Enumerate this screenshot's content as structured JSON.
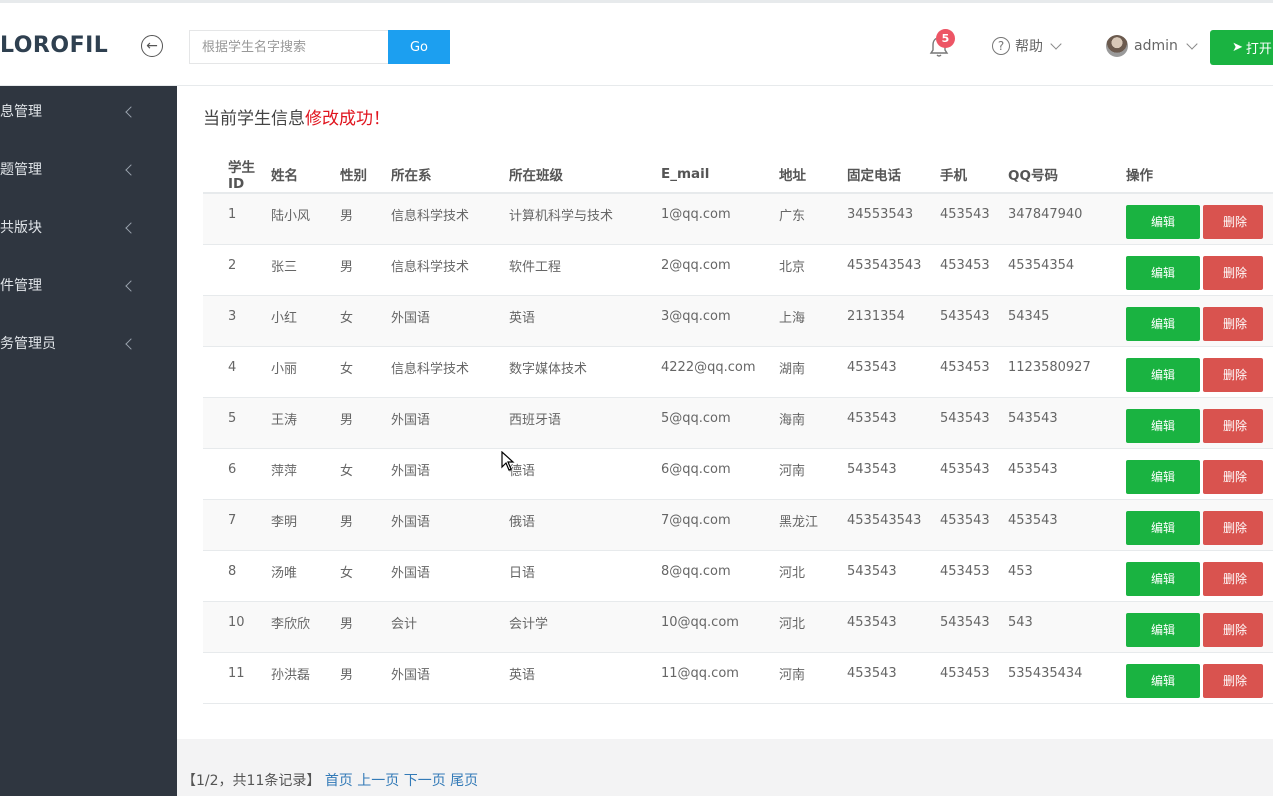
{
  "header": {
    "logo": "LOROFIL",
    "search_placeholder": "根据学生名字搜索",
    "go_label": "Go",
    "notification_count": "5",
    "help_label": "帮助",
    "user_name": "admin",
    "open_label": "打开"
  },
  "sidebar": {
    "items": [
      {
        "label": "息管理"
      },
      {
        "label": "题管理"
      },
      {
        "label": "共版块"
      },
      {
        "label": "件管理"
      },
      {
        "label": "务管理员"
      }
    ]
  },
  "message": {
    "prefix": "当前学生信息",
    "highlight": "修改成功！"
  },
  "table": {
    "columns": [
      "学生ID",
      "姓名",
      "性别",
      "所在系",
      "所在班级",
      "E_mail",
      "地址",
      "固定电话",
      "手机",
      "QQ号码",
      "操作"
    ],
    "edit_label": "编辑",
    "delete_label": "删除",
    "rows": [
      [
        "1",
        "陆小风",
        "男",
        "信息科学技术",
        "计算机科学与技术",
        "1@qq.com",
        "广东",
        "34553543",
        "453543",
        "347847940"
      ],
      [
        "2",
        "张三",
        "男",
        "信息科学技术",
        "软件工程",
        "2@qq.com",
        "北京",
        "453543543",
        "453453",
        "45354354"
      ],
      [
        "3",
        "小红",
        "女",
        "外国语",
        "英语",
        "3@qq.com",
        "上海",
        "2131354",
        "543543",
        "54345"
      ],
      [
        "4",
        "小丽",
        "女",
        "信息科学技术",
        "数字媒体技术",
        "4222@qq.com",
        "湖南",
        "453543",
        "453453",
        "1123580927"
      ],
      [
        "5",
        "王涛",
        "男",
        "外国语",
        "西班牙语",
        "5@qq.com",
        "海南",
        "453543",
        "543543",
        "543543"
      ],
      [
        "6",
        "萍萍",
        "女",
        "外国语",
        "德语",
        "6@qq.com",
        "河南",
        "543543",
        "453543",
        "453543"
      ],
      [
        "7",
        "李明",
        "男",
        "外国语",
        "俄语",
        "7@qq.com",
        "黑龙江",
        "453543543",
        "453543",
        "453543"
      ],
      [
        "8",
        "汤唯",
        "女",
        "外国语",
        "日语",
        "8@qq.com",
        "河北",
        "543543",
        "453453",
        "453"
      ],
      [
        "10",
        "李欣欣",
        "男",
        "会计",
        "会计学",
        "10@qq.com",
        "河北",
        "453543",
        "543543",
        "543"
      ],
      [
        "11",
        "孙洪磊",
        "男",
        "外国语",
        "英语",
        "11@qq.com",
        "河南",
        "453543",
        "453453",
        "535435434"
      ]
    ]
  },
  "pager": {
    "summary": "【1/2，共11条记录】",
    "first": "首页",
    "prev": "上一页",
    "next": "下一页",
    "last": "尾页"
  }
}
